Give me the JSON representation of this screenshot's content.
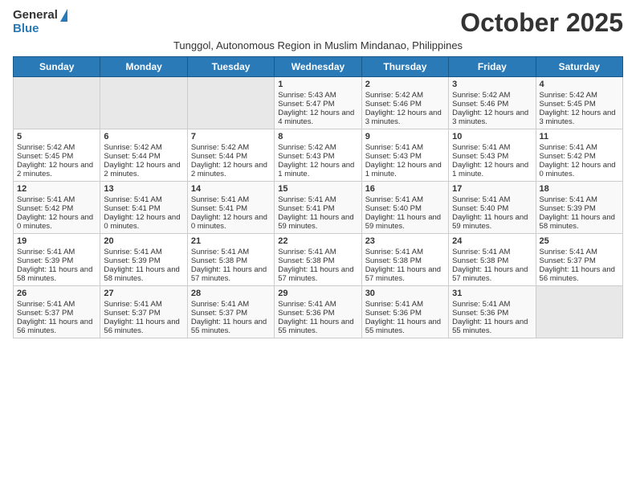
{
  "logo": {
    "general": "General",
    "blue": "Blue"
  },
  "title": "October 2025",
  "subtitle": "Tunggol, Autonomous Region in Muslim Mindanao, Philippines",
  "headers": [
    "Sunday",
    "Monday",
    "Tuesday",
    "Wednesday",
    "Thursday",
    "Friday",
    "Saturday"
  ],
  "weeks": [
    [
      {
        "day": "",
        "sunrise": "",
        "sunset": "",
        "daylight": "",
        "empty": true
      },
      {
        "day": "",
        "sunrise": "",
        "sunset": "",
        "daylight": "",
        "empty": true
      },
      {
        "day": "",
        "sunrise": "",
        "sunset": "",
        "daylight": "",
        "empty": true
      },
      {
        "day": "1",
        "sunrise": "Sunrise: 5:43 AM",
        "sunset": "Sunset: 5:47 PM",
        "daylight": "Daylight: 12 hours and 4 minutes."
      },
      {
        "day": "2",
        "sunrise": "Sunrise: 5:42 AM",
        "sunset": "Sunset: 5:46 PM",
        "daylight": "Daylight: 12 hours and 3 minutes."
      },
      {
        "day": "3",
        "sunrise": "Sunrise: 5:42 AM",
        "sunset": "Sunset: 5:46 PM",
        "daylight": "Daylight: 12 hours and 3 minutes."
      },
      {
        "day": "4",
        "sunrise": "Sunrise: 5:42 AM",
        "sunset": "Sunset: 5:45 PM",
        "daylight": "Daylight: 12 hours and 3 minutes."
      }
    ],
    [
      {
        "day": "5",
        "sunrise": "Sunrise: 5:42 AM",
        "sunset": "Sunset: 5:45 PM",
        "daylight": "Daylight: 12 hours and 2 minutes."
      },
      {
        "day": "6",
        "sunrise": "Sunrise: 5:42 AM",
        "sunset": "Sunset: 5:44 PM",
        "daylight": "Daylight: 12 hours and 2 minutes."
      },
      {
        "day": "7",
        "sunrise": "Sunrise: 5:42 AM",
        "sunset": "Sunset: 5:44 PM",
        "daylight": "Daylight: 12 hours and 2 minutes."
      },
      {
        "day": "8",
        "sunrise": "Sunrise: 5:42 AM",
        "sunset": "Sunset: 5:43 PM",
        "daylight": "Daylight: 12 hours and 1 minute."
      },
      {
        "day": "9",
        "sunrise": "Sunrise: 5:41 AM",
        "sunset": "Sunset: 5:43 PM",
        "daylight": "Daylight: 12 hours and 1 minute."
      },
      {
        "day": "10",
        "sunrise": "Sunrise: 5:41 AM",
        "sunset": "Sunset: 5:43 PM",
        "daylight": "Daylight: 12 hours and 1 minute."
      },
      {
        "day": "11",
        "sunrise": "Sunrise: 5:41 AM",
        "sunset": "Sunset: 5:42 PM",
        "daylight": "Daylight: 12 hours and 0 minutes."
      }
    ],
    [
      {
        "day": "12",
        "sunrise": "Sunrise: 5:41 AM",
        "sunset": "Sunset: 5:42 PM",
        "daylight": "Daylight: 12 hours and 0 minutes."
      },
      {
        "day": "13",
        "sunrise": "Sunrise: 5:41 AM",
        "sunset": "Sunset: 5:41 PM",
        "daylight": "Daylight: 12 hours and 0 minutes."
      },
      {
        "day": "14",
        "sunrise": "Sunrise: 5:41 AM",
        "sunset": "Sunset: 5:41 PM",
        "daylight": "Daylight: 12 hours and 0 minutes."
      },
      {
        "day": "15",
        "sunrise": "Sunrise: 5:41 AM",
        "sunset": "Sunset: 5:41 PM",
        "daylight": "Daylight: 11 hours and 59 minutes."
      },
      {
        "day": "16",
        "sunrise": "Sunrise: 5:41 AM",
        "sunset": "Sunset: 5:40 PM",
        "daylight": "Daylight: 11 hours and 59 minutes."
      },
      {
        "day": "17",
        "sunrise": "Sunrise: 5:41 AM",
        "sunset": "Sunset: 5:40 PM",
        "daylight": "Daylight: 11 hours and 59 minutes."
      },
      {
        "day": "18",
        "sunrise": "Sunrise: 5:41 AM",
        "sunset": "Sunset: 5:39 PM",
        "daylight": "Daylight: 11 hours and 58 minutes."
      }
    ],
    [
      {
        "day": "19",
        "sunrise": "Sunrise: 5:41 AM",
        "sunset": "Sunset: 5:39 PM",
        "daylight": "Daylight: 11 hours and 58 minutes."
      },
      {
        "day": "20",
        "sunrise": "Sunrise: 5:41 AM",
        "sunset": "Sunset: 5:39 PM",
        "daylight": "Daylight: 11 hours and 58 minutes."
      },
      {
        "day": "21",
        "sunrise": "Sunrise: 5:41 AM",
        "sunset": "Sunset: 5:38 PM",
        "daylight": "Daylight: 11 hours and 57 minutes."
      },
      {
        "day": "22",
        "sunrise": "Sunrise: 5:41 AM",
        "sunset": "Sunset: 5:38 PM",
        "daylight": "Daylight: 11 hours and 57 minutes."
      },
      {
        "day": "23",
        "sunrise": "Sunrise: 5:41 AM",
        "sunset": "Sunset: 5:38 PM",
        "daylight": "Daylight: 11 hours and 57 minutes."
      },
      {
        "day": "24",
        "sunrise": "Sunrise: 5:41 AM",
        "sunset": "Sunset: 5:38 PM",
        "daylight": "Daylight: 11 hours and 57 minutes."
      },
      {
        "day": "25",
        "sunrise": "Sunrise: 5:41 AM",
        "sunset": "Sunset: 5:37 PM",
        "daylight": "Daylight: 11 hours and 56 minutes."
      }
    ],
    [
      {
        "day": "26",
        "sunrise": "Sunrise: 5:41 AM",
        "sunset": "Sunset: 5:37 PM",
        "daylight": "Daylight: 11 hours and 56 minutes."
      },
      {
        "day": "27",
        "sunrise": "Sunrise: 5:41 AM",
        "sunset": "Sunset: 5:37 PM",
        "daylight": "Daylight: 11 hours and 56 minutes."
      },
      {
        "day": "28",
        "sunrise": "Sunrise: 5:41 AM",
        "sunset": "Sunset: 5:37 PM",
        "daylight": "Daylight: 11 hours and 55 minutes."
      },
      {
        "day": "29",
        "sunrise": "Sunrise: 5:41 AM",
        "sunset": "Sunset: 5:36 PM",
        "daylight": "Daylight: 11 hours and 55 minutes."
      },
      {
        "day": "30",
        "sunrise": "Sunrise: 5:41 AM",
        "sunset": "Sunset: 5:36 PM",
        "daylight": "Daylight: 11 hours and 55 minutes."
      },
      {
        "day": "31",
        "sunrise": "Sunrise: 5:41 AM",
        "sunset": "Sunset: 5:36 PM",
        "daylight": "Daylight: 11 hours and 55 minutes."
      },
      {
        "day": "",
        "sunrise": "",
        "sunset": "",
        "daylight": "",
        "empty": true
      }
    ]
  ]
}
